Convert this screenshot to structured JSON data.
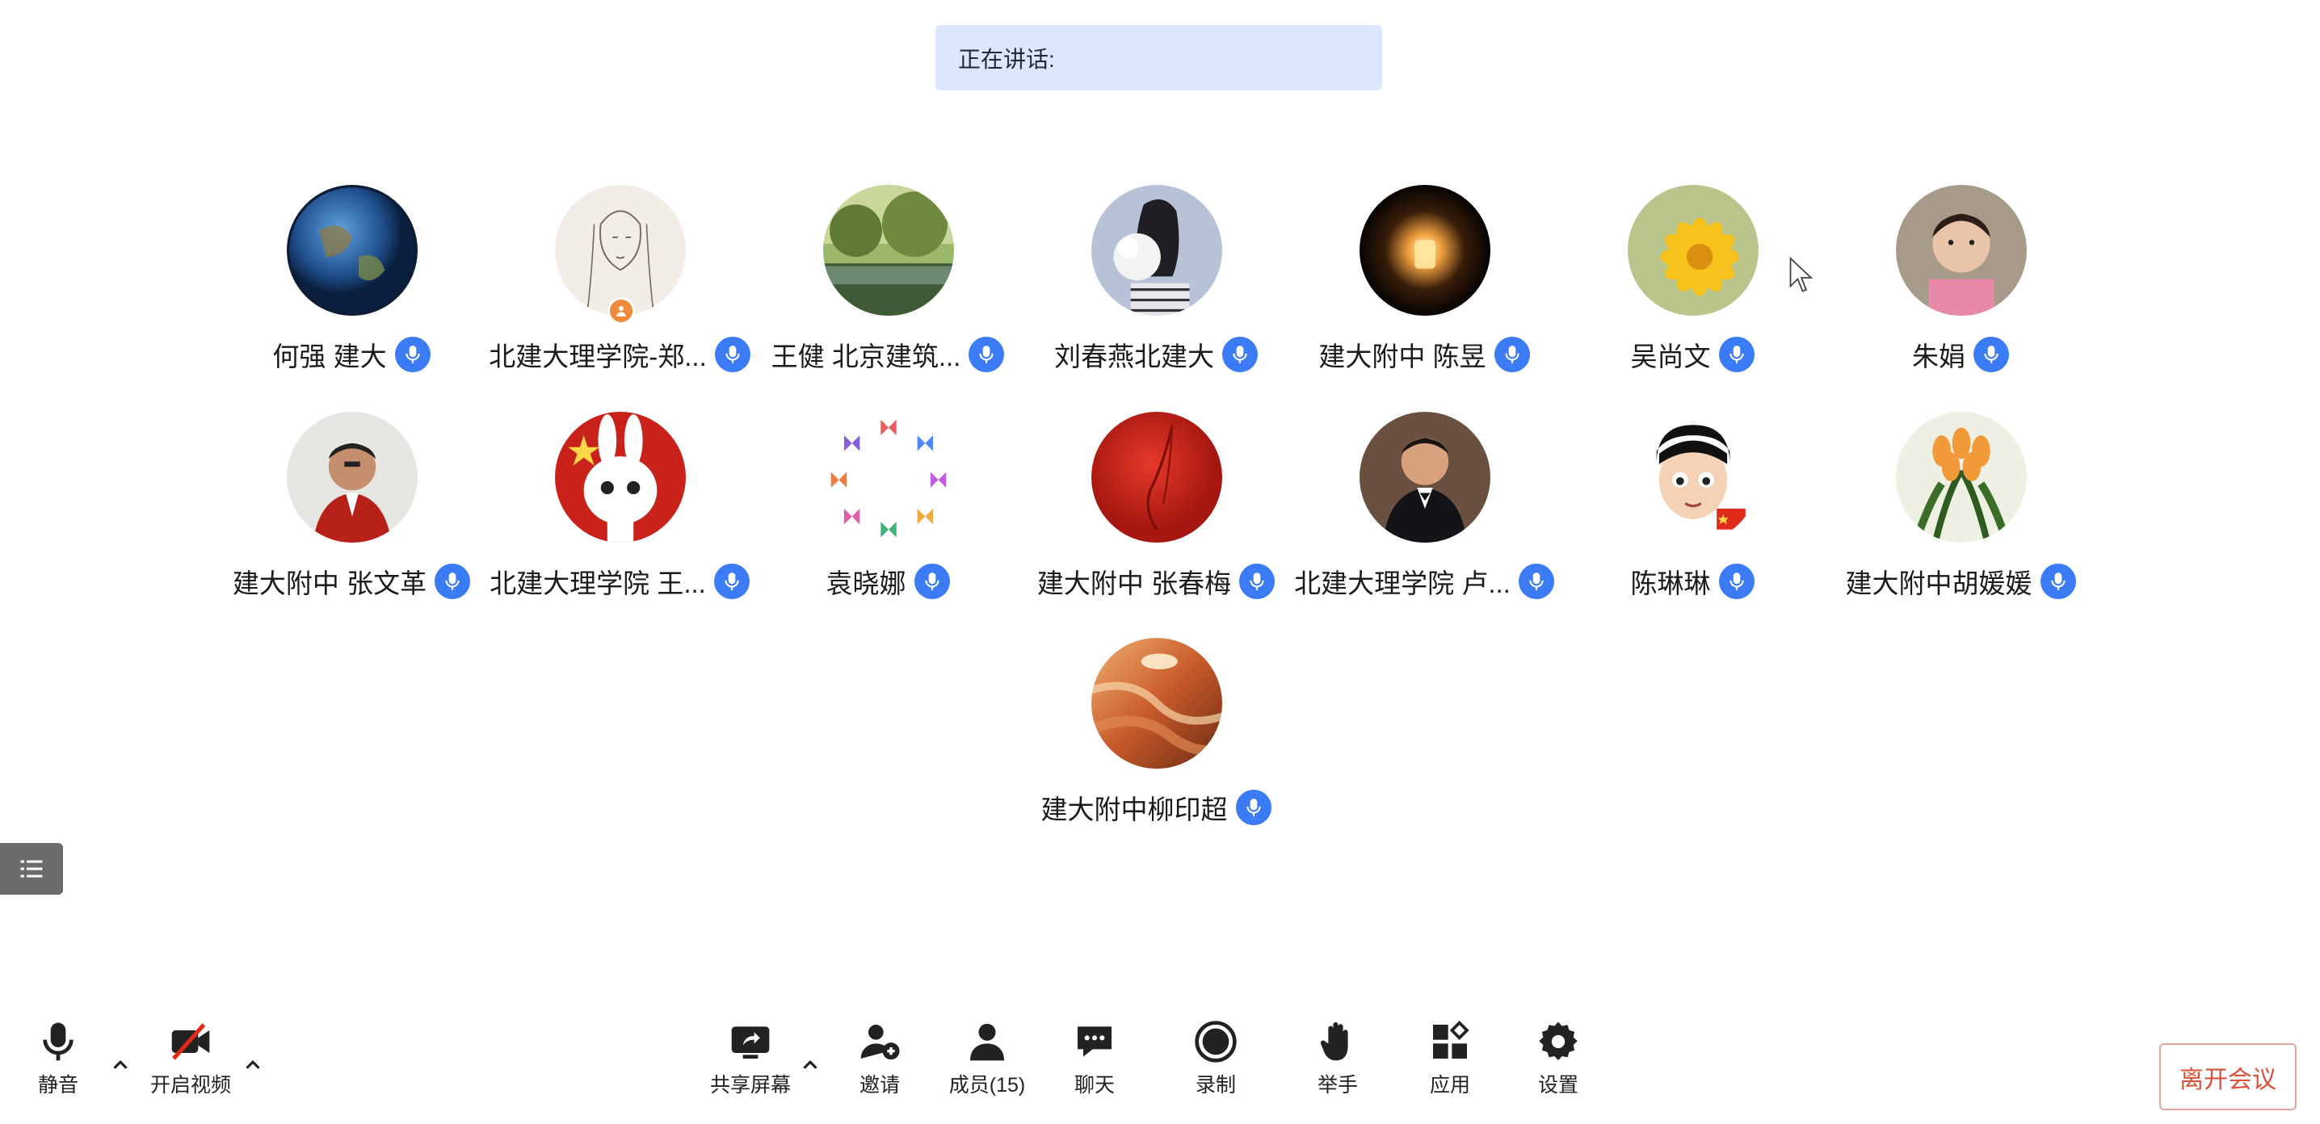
{
  "speaking": {
    "label": "正在讲话:"
  },
  "participants": [
    {
      "name": "何强 建大"
    },
    {
      "name": "北建大理学院-郑..."
    },
    {
      "name": "王健  北京建筑..."
    },
    {
      "name": "刘春燕北建大"
    },
    {
      "name": "建大附中  陈昱"
    },
    {
      "name": "吴尚文"
    },
    {
      "name": "朱娟"
    },
    {
      "name": "建大附中 张文革"
    },
    {
      "name": "北建大理学院 王..."
    },
    {
      "name": "袁晓娜"
    },
    {
      "name": "建大附中 张春梅"
    },
    {
      "name": "北建大理学院 卢..."
    },
    {
      "name": "陈琳琳"
    },
    {
      "name": "建大附中胡媛媛"
    },
    {
      "name": "建大附中柳印超"
    }
  ],
  "toolbar": {
    "mute": "静音",
    "video": "开启视频",
    "share": "共享屏幕",
    "invite": "邀请",
    "members": "成员(15)",
    "chat": "聊天",
    "record": "录制",
    "raise_hand": "举手",
    "apps": "应用",
    "settings": "设置",
    "leave": "离开会议"
  },
  "colors": {
    "accent": "#3b7cf6",
    "banner": "#dbe8fb",
    "leave": "#d9513b",
    "host_badge": "#f08a3c"
  }
}
